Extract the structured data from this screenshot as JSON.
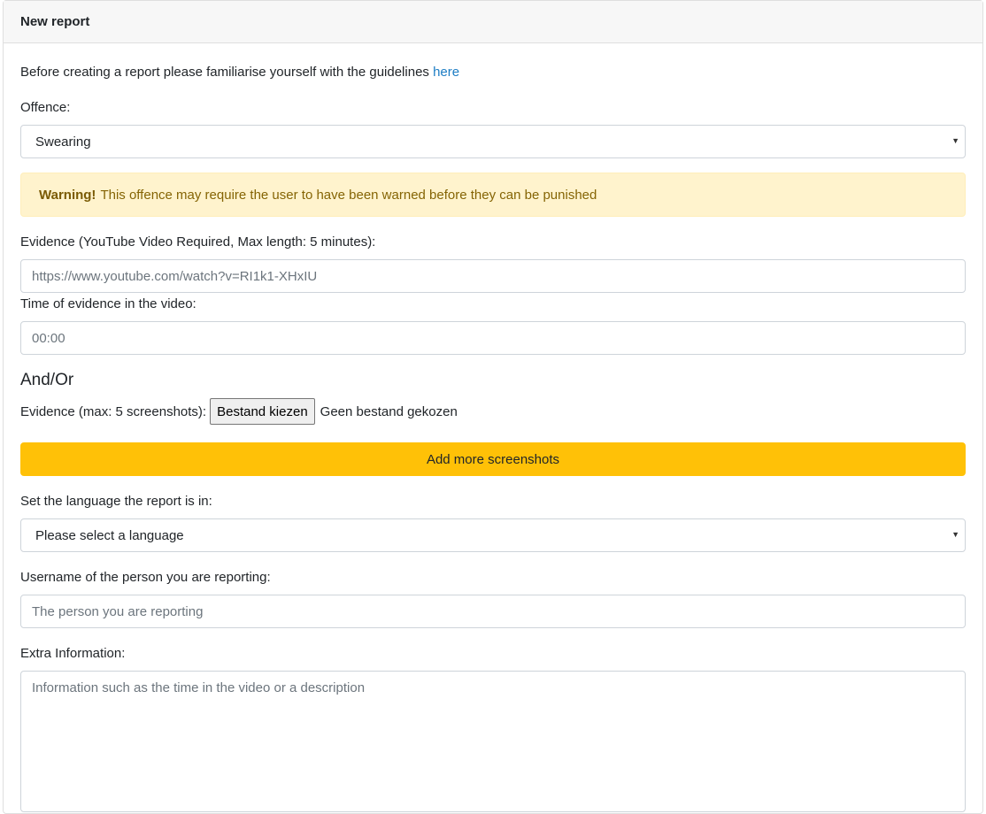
{
  "card": {
    "title": "New report"
  },
  "intro": {
    "text": "Before creating a report please familiarise yourself with the guidelines ",
    "link": "here"
  },
  "offence": {
    "label": "Offence:",
    "selected": "Swearing"
  },
  "warning": {
    "strong": "Warning!",
    "text": "This offence may require the user to have been warned before they can be punished"
  },
  "evidence_video": {
    "label": "Evidence (YouTube Video Required, Max length: 5 minutes):",
    "placeholder": "https://www.youtube.com/watch?v=RI1k1-XHxIU"
  },
  "evidence_time": {
    "label": "Time of evidence in the video:",
    "placeholder": "00:00"
  },
  "and_or": "And/Or",
  "screenshots": {
    "label": "Evidence (max: 5 screenshots):",
    "button": "Bestand kiezen",
    "status": "Geen bestand gekozen",
    "add_more": "Add more screenshots"
  },
  "language": {
    "label": "Set the language the report is in:",
    "selected": "Please select a language"
  },
  "username": {
    "label": "Username of the person you are reporting:",
    "placeholder": "The person you are reporting"
  },
  "extra": {
    "label": "Extra Information:",
    "placeholder": "Information such as the time in the video or a description"
  },
  "icons": {
    "dropdown": "caret-down-icon"
  },
  "colors": {
    "link": "#1d7dc4",
    "warning_bg": "#fff3cd",
    "warning_text": "#856404",
    "button_warning": "#ffc107"
  }
}
